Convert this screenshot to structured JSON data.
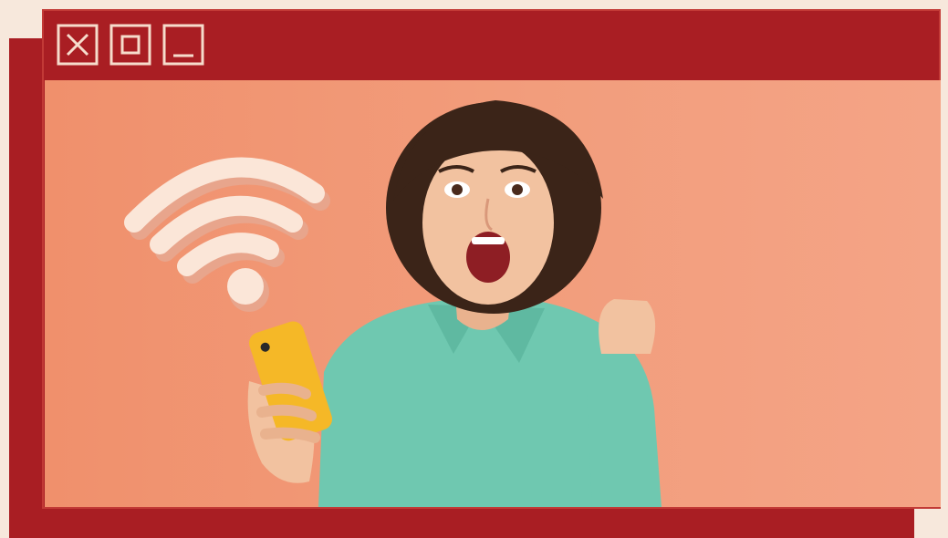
{
  "window": {
    "controls": [
      {
        "name": "close",
        "icon": "close-icon"
      },
      {
        "name": "maximize",
        "icon": "maximize-icon"
      },
      {
        "name": "minimize",
        "icon": "minimize-icon"
      }
    ],
    "frame_color": "#a91e23",
    "control_color": "#f6dccc"
  },
  "scene": {
    "background_color": "#f29a78",
    "wifi_color": "#fbe6d8",
    "phone_color": "#f5b827",
    "shirt_color": "#6fc8b0",
    "hair_color": "#3b2418",
    "skin_color": "#f2c2a0"
  }
}
